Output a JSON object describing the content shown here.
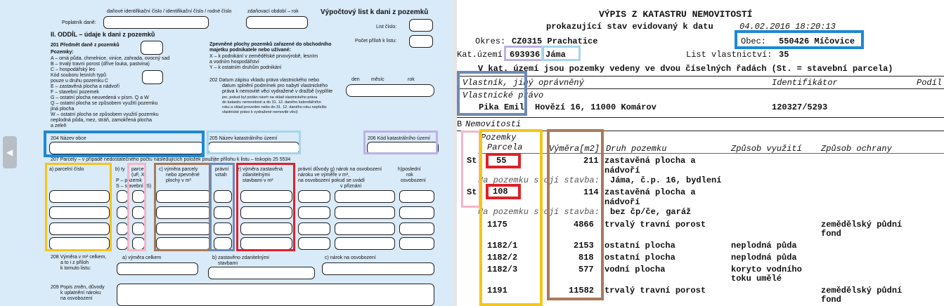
{
  "form": {
    "header_col1": "daňové identifikační číslo / identifikační číslo / rodné číslo",
    "header_col2": "zdaňovací období – rok",
    "title": "Výpočtový list k dani z pozemků",
    "poplatnik": "Poplatník daně:",
    "list_cislo": "List číslo:",
    "pocet_priloh": "Počet příloh k listu:",
    "section": "II. ODDÍL – údaje k dani z pozemků",
    "r201": "201  Předmět daně z pozemků",
    "pozemky": "Pozemky:",
    "legend": [
      "A – orná půda, chmelnice, vinice, zahrada, ovocný sad",
      "B – trvalý travní porost (dříve louka, pastvina)",
      "C – hospodářský les",
      "     Kód souboru lesních typů",
      "     pouze u druhu pozemku C",
      "E – zastavěná plocha a nádvoří",
      "F – stavební pozemek",
      "G – ostatní plocha neuvedená v písm. Q a W",
      "Q – ostatní plocha se způsobem využití pozemku",
      "     jiná plocha",
      "W – ostatní plocha se způsobem využití pozemku",
      "     neplodná půda, mez, stráň, zamokřená plocha",
      "     a zeleň"
    ],
    "zpevnene": [
      "Zpevněné plochy pozemků zařazené do obchodního",
      "majetku podnikatele nebo užívané:",
      "X – k podnikání v zemědělské prvovýrobě, lesním",
      "     a vodním hospodářství",
      "Y – k ostatním druhům podnikání"
    ],
    "r202": [
      "202  Datum zápisu vkladu práva vlastnického nebo",
      "datum splnění podmínek pro nabytí vlastnického",
      "práva k nemovité věci vydražené v dražbě (vyplňte",
      "jen, pokud byl podán návrh na vklad vlastnického práva",
      "do katastru nemovitostí a do 31. 12. daného kalendářního",
      "roku a vklad proveden nebo do 31. 12. daného roku nepřešlo",
      "vlastnické právo k vydražené nemovité věci)"
    ],
    "den": "den",
    "mesic": "měsíc",
    "rok": "rok",
    "r204": "204  Název obce",
    "r205": "205  Název katastrálního území",
    "r206": "206  Kód katastrálního území",
    "r207": "207  Parcely – v případě nedostatečného počtu následujících položek použijte přílohu k listu – tiskopis 25 5534",
    "colA": "a) parcelní číslo",
    "colB1": "b) ty",
    "colB2": "parcel",
    "colB3": "(uF, X",
    "colB4": "P – pozemk",
    "colB5": "S – stavební (S)",
    "colC": [
      "c) výměra parcely",
      "nebo zpevněné",
      "plochy v m²"
    ],
    "colD": [
      "právní",
      "vztah"
    ],
    "colE": [
      "e) výměra zastavěná",
      "zdanitelnými",
      "stavbami v m²"
    ],
    "colF": [
      "právní důvody g) nárok na osvobození",
      "nároku       ve výměře v m²,",
      "na osvobození   pokud se uvádí",
      "v přiznání"
    ],
    "colH": [
      "h)poslední",
      "rok",
      "osvobození"
    ],
    "r208": [
      "208  Výměra v m² celkem,",
      "a to i z příloh",
      "k tomuto listu:"
    ],
    "r208a": "a) výměra celkem",
    "r208b": [
      "b) zastavěno zdanitelnými",
      "stavbami"
    ],
    "r208c": "c) nárok na osvobození",
    "r209": [
      "209  Popis změn, důvody",
      "k uplatnění nároku",
      "na osvobození"
    ]
  },
  "doc": {
    "title": "VÝPIS Z KATASTRU NEMOVITOSTÍ",
    "subtitle_prefix": "prokazující stav evidovaný k datu",
    "subtitle_date": "04.02.2016 18:20:13",
    "okres_label": "Okres:",
    "okres_value": "CZ0315 Prachatice",
    "obec_label": "Obec:",
    "obec_value": "550426 Míčovice",
    "katuzemi_label": "Kat.území:",
    "katuzemi_code": "693936",
    "katuzemi_name": "Jáma",
    "list_label": "List vlastnictví:",
    "list_value": "35",
    "rady_note": "V kat. území jsou pozemky vedeny ve dvou číselných řadách  (St. = stavební parcela)",
    "sectionA_label": "Vlastník, jiný oprávněný",
    "identifikator": "Identifikátor",
    "podil": "Podíl",
    "vlastnicke": "Vlastnické právo",
    "owner_name": "Pika Emil",
    "owner_address": "Hovězí 16, 11000 Komárov",
    "owner_id": "120327/5293",
    "sectionB_letter": "B",
    "sectionB_label": "Nemovitosti",
    "pozemky": "Pozemky",
    "col_parcela": "Parcela",
    "col_vymera": "Výměra[m2]",
    "col_druh": "Druh pozemku",
    "col_zpusob_vyuziti": "Způsob využití",
    "col_zpusob_ochrany": "Způsob ochrany",
    "st1": "St.",
    "parcel1": "55",
    "vymera1": "211",
    "druh1a": "zastavěná plocha a",
    "druh1b": "nádvoří",
    "stavba1_label": "Na pozemku stojí stavba:",
    "stavba1_value": "Jáma, č.p. 16, bydlení",
    "st2": "St.",
    "parcel2": "108",
    "vymera2": "114",
    "druh2a": "zastavěná plocha a",
    "druh2b": "nádvoří",
    "stavba2_label": "Na pozemku stojí stavba:",
    "stavba2_value": "bez čp/če, garáž",
    "rows": [
      {
        "parcela": "1175",
        "vymera": "4866",
        "druh": "trvalý travní porost",
        "vyuziti": "",
        "ochrana": "zemědělský půdní",
        "ochrana2": "fond"
      },
      {
        "parcela": "1182/1",
        "vymera": "2153",
        "druh": "ostatní plocha",
        "vyuziti": "neplodná půda",
        "ochrana": "",
        "ochrana2": ""
      },
      {
        "parcela": "1182/2",
        "vymera": "818",
        "druh": "ostatní plocha",
        "vyuziti": "neplodná půda",
        "ochrana": "",
        "ochrana2": ""
      },
      {
        "parcela": "1182/3",
        "vymera": "577",
        "druh": "vodní plocha",
        "vyuziti": "koryto vodního",
        "vyuziti2": "toku umělé",
        "ochrana": "",
        "ochrana2": ""
      },
      {
        "parcela": "1191",
        "vymera": "11582",
        "druh": "trvalý travní porost",
        "vyuziti": "",
        "ochrana": "zemědělský půdní",
        "ochrana2": "fond"
      }
    ]
  },
  "highlight_colors": {
    "blue": "#1e88d4",
    "light_blue": "#a6d6ea",
    "lavender": "#bdb1e4",
    "yellow": "#f5c518",
    "pink": "#f4b6c8",
    "brown": "#a97a5a",
    "steel": "#6d89b8",
    "red": "#e0202a"
  }
}
